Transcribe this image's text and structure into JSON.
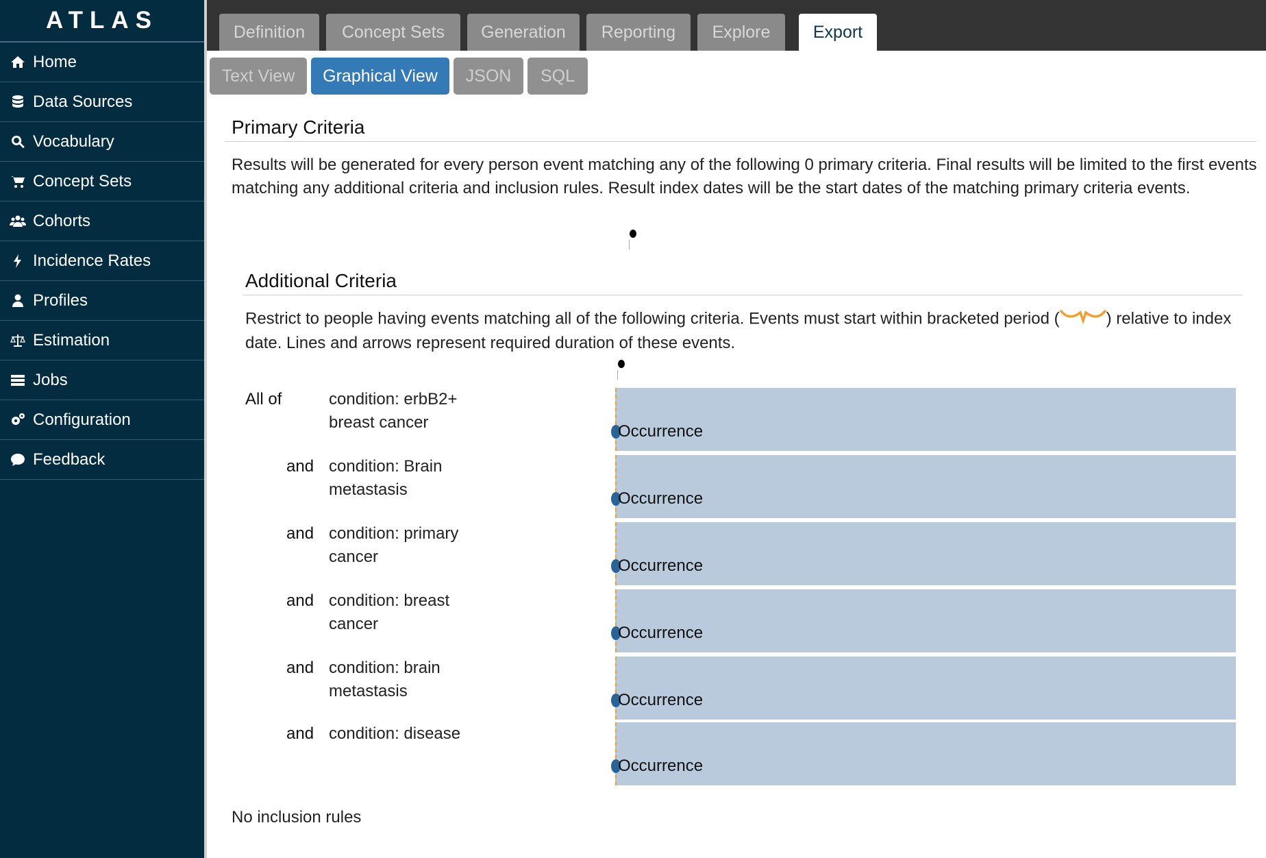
{
  "app": {
    "brand": "ATLAS"
  },
  "sidebar": {
    "items": [
      {
        "label": "Home",
        "icon": "home-icon"
      },
      {
        "label": "Data Sources",
        "icon": "database-icon"
      },
      {
        "label": "Vocabulary",
        "icon": "search-icon"
      },
      {
        "label": "Concept Sets",
        "icon": "cart-icon"
      },
      {
        "label": "Cohorts",
        "icon": "users-icon"
      },
      {
        "label": "Incidence Rates",
        "icon": "bolt-icon"
      },
      {
        "label": "Profiles",
        "icon": "user-icon"
      },
      {
        "label": "Estimation",
        "icon": "balance-scale-icon"
      },
      {
        "label": "Jobs",
        "icon": "tasks-icon"
      },
      {
        "label": "Configuration",
        "icon": "gears-icon"
      },
      {
        "label": "Feedback",
        "icon": "comment-icon"
      }
    ]
  },
  "tabs": {
    "items": [
      {
        "label": "Definition"
      },
      {
        "label": "Concept Sets"
      },
      {
        "label": "Generation"
      },
      {
        "label": "Reporting"
      },
      {
        "label": "Explore"
      },
      {
        "label": "Export"
      }
    ],
    "active": "Export"
  },
  "subtabs": {
    "items": [
      {
        "label": "Text View"
      },
      {
        "label": "Graphical View"
      },
      {
        "label": "JSON"
      },
      {
        "label": "SQL"
      }
    ],
    "active": "Graphical View"
  },
  "primary": {
    "title": "Primary Criteria",
    "description": "Results will be generated for every person event matching any of the following 0 primary criteria. Final results will be limited to the first events matching any additional criteria and inclusion rules. Result index dates will be the start dates of the matching primary criteria events."
  },
  "additional": {
    "title": "Additional Criteria",
    "description_before": "Restrict to people having events matching all of the following criteria. Events must start within bracketed period (",
    "description_after": ") relative to index date. Lines and arrows represent required duration of these events.",
    "criteria": [
      {
        "conjunction": "All of",
        "text": "condition: erbB2+ breast cancer",
        "bar_label": "Occurrence"
      },
      {
        "conjunction": "and",
        "text": "condition: Brain metastasis",
        "bar_label": "Occurrence"
      },
      {
        "conjunction": "and",
        "text": "condition: primary cancer",
        "bar_label": "Occurrence"
      },
      {
        "conjunction": "and",
        "text": "condition: breast cancer",
        "bar_label": "Occurrence"
      },
      {
        "conjunction": "and",
        "text": "condition: brain metastasis",
        "bar_label": "Occurrence"
      },
      {
        "conjunction": "and",
        "text": "condition: disease",
        "bar_label": "Occurrence"
      }
    ]
  },
  "inclusion": {
    "text": "No inclusion rules"
  },
  "colors": {
    "sidebar": "#032c41",
    "topbar": "#333333",
    "active_subtab": "#337ab7",
    "bar": "#b8cadb",
    "bracket": "#f0a030"
  }
}
